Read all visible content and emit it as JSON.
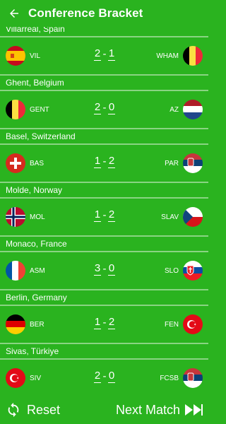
{
  "app": {
    "title": "Conference Bracket"
  },
  "matches": [
    {
      "location": "Villarreal, Spain",
      "home": "VIL",
      "away": "WHAM",
      "home_score": "2",
      "away_score": "1",
      "separator": "-"
    },
    {
      "location": "Ghent, Belgium",
      "home": "GENT",
      "away": "AZ",
      "home_score": "2",
      "away_score": "0",
      "separator": "-"
    },
    {
      "location": "Basel, Switzerland",
      "home": "BAS",
      "away": "PAR",
      "home_score": "1",
      "away_score": "2",
      "separator": "-"
    },
    {
      "location": "Molde, Norway",
      "home": "MOL",
      "away": "SLAV",
      "home_score": "1",
      "away_score": "2",
      "separator": "-"
    },
    {
      "location": "Monaco, France",
      "home": "ASM",
      "away": "SLO",
      "home_score": "3",
      "away_score": "0",
      "separator": "-"
    },
    {
      "location": "Berlin, Germany",
      "home": "BER",
      "away": "FEN",
      "home_score": "1",
      "away_score": "2",
      "separator": "-"
    },
    {
      "location": "Sivas, Türkiye",
      "home": "SIV",
      "away": "FCSB",
      "home_score": "2",
      "away_score": "0",
      "separator": "-"
    }
  ],
  "flags": [
    [
      "spain-flag-icon",
      "belgium-flag-icon"
    ],
    [
      "belgium-flag-icon",
      "netherlands-flag-icon"
    ],
    [
      "switzerland-flag-icon",
      "serbia-flag-icon"
    ],
    [
      "norway-flag-icon",
      "czech-flag-icon"
    ],
    [
      "france-flag-icon",
      "slovakia-flag-icon"
    ],
    [
      "germany-flag-icon",
      "turkey-flag-icon"
    ],
    [
      "turkey-flag-icon",
      "serbia-flag-icon"
    ]
  ],
  "footer": {
    "reset_label": "Reset",
    "next_label": "Next Match"
  },
  "colors": {
    "background": "#2ab31f",
    "divider": "#8ad483",
    "text": "#ffffff"
  }
}
